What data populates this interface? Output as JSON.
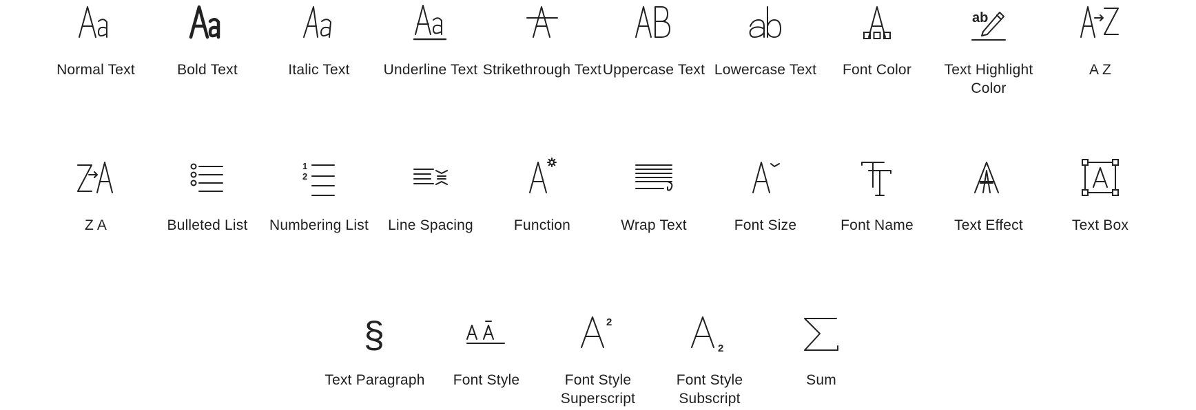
{
  "stroke_color": "#222222",
  "rows": [
    {
      "items": [
        {
          "label": "Normal Text",
          "icon": "normal-text-icon"
        },
        {
          "label": "Bold Text",
          "icon": "bold-text-icon"
        },
        {
          "label": "Italic Text",
          "icon": "italic-text-icon"
        },
        {
          "label": "Underline Text",
          "icon": "underline-text-icon"
        },
        {
          "label": "Strikethrough Text",
          "icon": "strikethrough-text-icon"
        },
        {
          "label": "Uppercase Text",
          "icon": "uppercase-text-icon"
        },
        {
          "label": "Lowercase Text",
          "icon": "lowercase-text-icon"
        },
        {
          "label": "Font Color",
          "icon": "font-color-icon"
        },
        {
          "label": "Text Highlight Color",
          "icon": "text-highlight-color-icon"
        },
        {
          "label": "A Z",
          "icon": "sort-a-z-icon"
        }
      ]
    },
    {
      "items": [
        {
          "label": "Z A",
          "icon": "sort-z-a-icon"
        },
        {
          "label": "Bulleted List",
          "icon": "bulleted-list-icon"
        },
        {
          "label": "Numbering List",
          "icon": "numbering-list-icon"
        },
        {
          "label": "Line Spacing",
          "icon": "line-spacing-icon"
        },
        {
          "label": "Function",
          "icon": "function-icon"
        },
        {
          "label": "Wrap Text",
          "icon": "wrap-text-icon"
        },
        {
          "label": "Font Size",
          "icon": "font-size-icon"
        },
        {
          "label": "Font Name",
          "icon": "font-name-icon"
        },
        {
          "label": "Text Effect",
          "icon": "text-effect-icon"
        },
        {
          "label": "Text Box",
          "icon": "text-box-icon"
        }
      ]
    },
    {
      "items": [
        {
          "label": "Text Paragraph",
          "icon": "section-sign-icon"
        },
        {
          "label": "Font Style",
          "icon": "font-style-icon"
        },
        {
          "label": "Font Style Superscript",
          "icon": "superscript-icon"
        },
        {
          "label": "Font Style Subscript",
          "icon": "subscript-icon"
        },
        {
          "label": "Sum",
          "icon": "sum-icon"
        }
      ]
    }
  ]
}
